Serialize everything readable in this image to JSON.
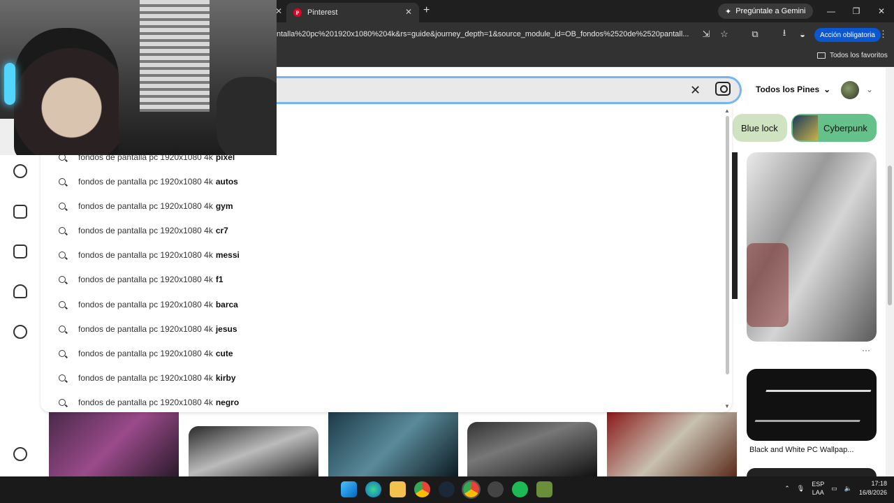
{
  "browser": {
    "tab_title": "Pinterest",
    "gemini_label": "Pregúntale a Gemini",
    "url": "ntalla%20pc%201920x1080%204k&rs=guide&journey_depth=1&source_module_id=OB_fondos%2520de%2520pantall...",
    "action_label": "Acción obligatoria",
    "favorites_label": "Todos los favoritos",
    "window_controls": [
      "—",
      "❐",
      "✕"
    ]
  },
  "header": {
    "scope_label": "Todos los Pines",
    "clear_icon": "close-icon",
    "camera_icon": "camera-icon"
  },
  "chips": [
    {
      "label": "Blue lock"
    },
    {
      "label": "Cyberpunk"
    }
  ],
  "suggestion_prefix": "fondos de pantalla pc 1920x1080 4k",
  "suggestions": [
    {
      "prefix": "fondos de pantalla pc 1920x1080 4k",
      "suffix": "pixel"
    },
    {
      "prefix": "fondos de pantalla pc 1920x1080 4k",
      "suffix": "autos"
    },
    {
      "prefix": "fondos de pantalla pc 1920x1080 4k",
      "suffix": "gym"
    },
    {
      "prefix": "fondos de pantalla pc 1920x1080 4k",
      "suffix": "cr7"
    },
    {
      "prefix": "fondos de pantalla pc 1920x1080 4k",
      "suffix": "messi"
    },
    {
      "prefix": "fondos de pantalla pc 1920x1080 4k",
      "suffix": "f1"
    },
    {
      "prefix": "fondos de pantalla pc 1920x1080 4k",
      "suffix": "barca"
    },
    {
      "prefix": "fondos de pantalla pc 1920x1080 4k",
      "suffix": "jesus"
    },
    {
      "prefix": "fondos de pantalla pc 1920x1080 4k",
      "suffix": "cute"
    },
    {
      "prefix": "fondos de pantalla pc 1920x1080 4k",
      "suffix": "kirby"
    },
    {
      "prefix": "fondos de pantalla pc 1920x1080 4k",
      "suffix": "negro"
    }
  ],
  "pins": {
    "pin2_title": "Black and White PC Wallpap...",
    "more_label": "···"
  },
  "taskbar": {
    "lang_top": "ESP",
    "lang_bottom": "LAA",
    "time": "17:18",
    "date": "16/8/2026"
  }
}
